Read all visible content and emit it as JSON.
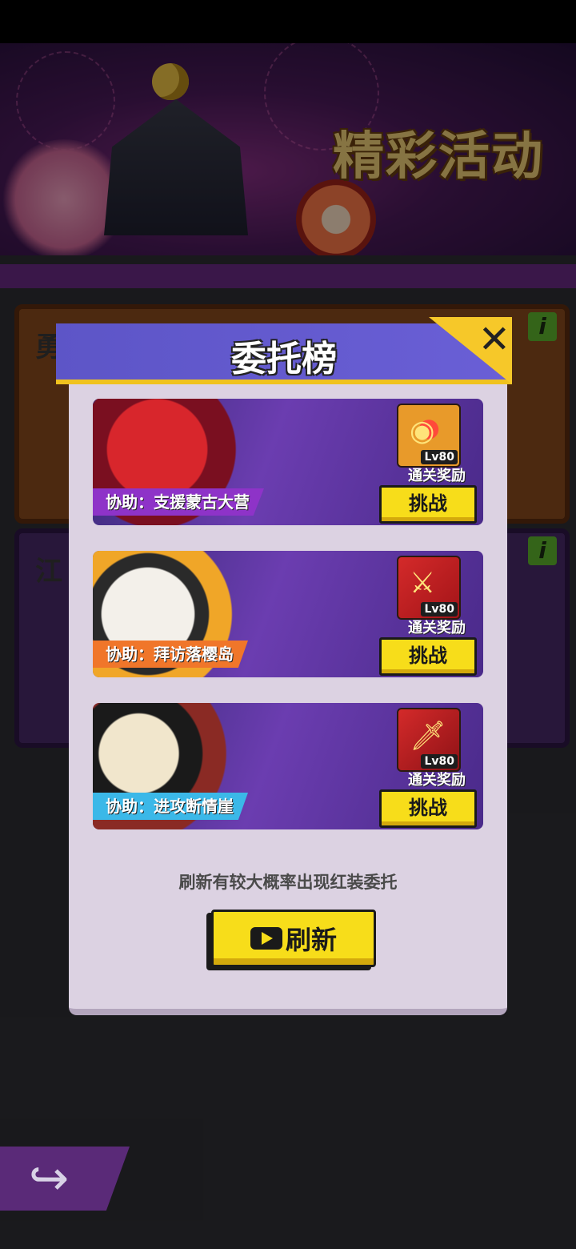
{
  "banner": {
    "title": "精彩活动"
  },
  "background": {
    "card1_label": "勇",
    "card2_label": "江",
    "info_glyph": "i"
  },
  "dialog": {
    "title": "委托榜",
    "close_glyph": "✕",
    "tasks": [
      {
        "tag": "协助：支援蒙古大营",
        "reward_level": "Lv80",
        "reward_label": "通关奖励",
        "button": "挑战"
      },
      {
        "tag": "协助：拜访落樱岛",
        "reward_level": "Lv80",
        "reward_label": "通关奖励",
        "button": "挑战"
      },
      {
        "tag": "协助：进攻断情崖",
        "reward_level": "Lv80",
        "reward_label": "通关奖励",
        "button": "挑战"
      }
    ],
    "refresh_hint": "刷新有较大概率出现红装委托",
    "refresh_button": "刷新"
  },
  "nav": {
    "back_glyph": "↩"
  },
  "colors": {
    "accent_yellow": "#f7dd1a",
    "header_purple": "#6a5fd6",
    "dialog_bg": "#dcd2e2"
  }
}
